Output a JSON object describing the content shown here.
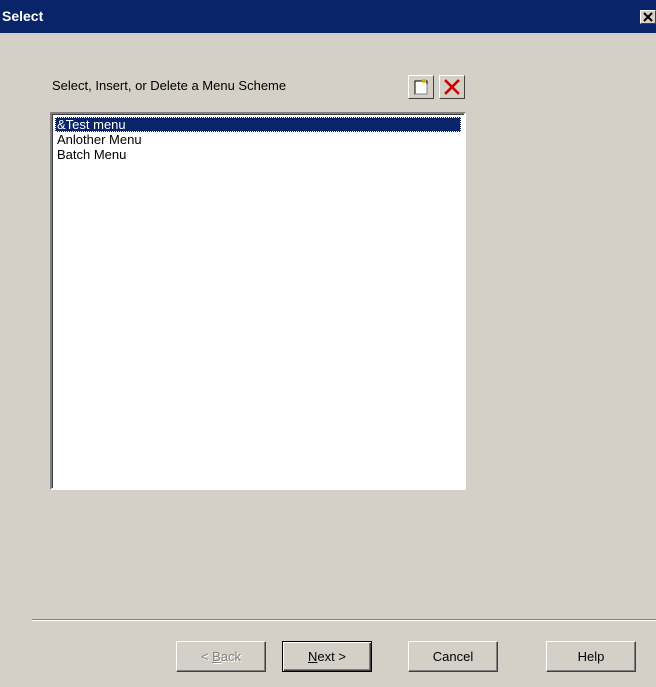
{
  "window": {
    "title": "Select"
  },
  "prompt": {
    "label": "Select, Insert, or Delete a Menu Scheme"
  },
  "toolbar": {
    "new_icon": "new-document-icon",
    "delete_icon": "delete-x-icon"
  },
  "menu_schemes": {
    "items": [
      {
        "label": "&Test menu",
        "selected": true
      },
      {
        "label": "Anlother Menu",
        "selected": false
      },
      {
        "label": "Batch Menu",
        "selected": false
      }
    ]
  },
  "buttons": {
    "back": {
      "prefix": "< ",
      "accel": "B",
      "rest": "ack",
      "enabled": false
    },
    "next": {
      "accel": "N",
      "rest": "ext >",
      "enabled": true
    },
    "cancel": {
      "label": "Cancel",
      "enabled": true
    },
    "help": {
      "label": "Help",
      "enabled": true
    }
  },
  "colors": {
    "titlebar": "#0a246a",
    "face": "#d4d0c8",
    "selection": "#0a246a",
    "delete_red": "#cc0000"
  }
}
